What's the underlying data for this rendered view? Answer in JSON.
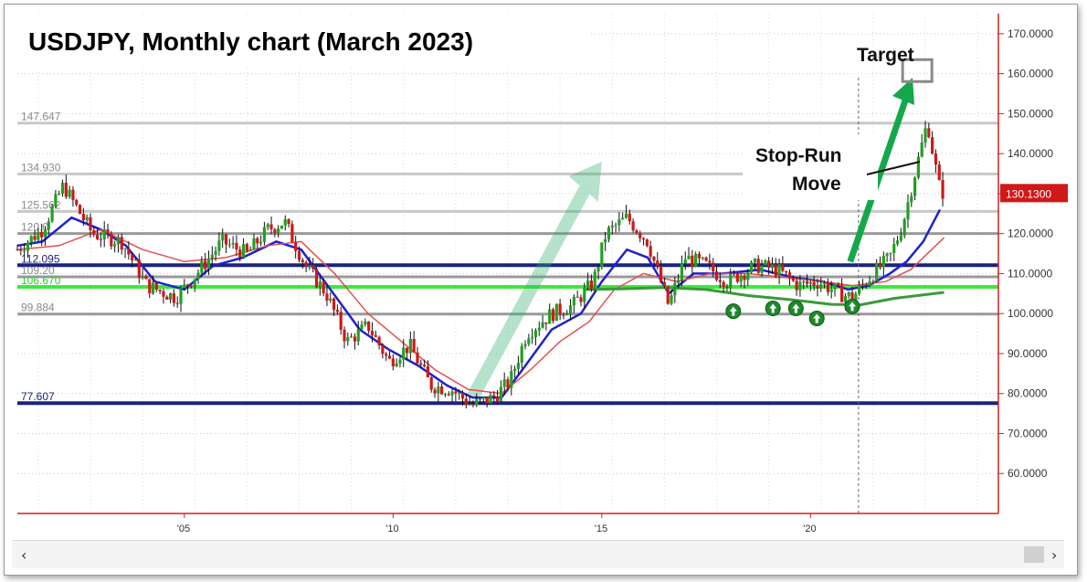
{
  "title": "USDJPY, Monthly chart (March 2023)",
  "chart_data": {
    "type": "candlestick",
    "instrument": "USDJPY",
    "timeframe": "Monthly",
    "current_price": "130.1300",
    "y_axis": {
      "range": [
        50,
        175
      ],
      "ticks": [
        "60.0000",
        "70.0000",
        "80.0000",
        "90.0000",
        "100.0000",
        "110.0000",
        "120.0000",
        "130.0000",
        "140.0000",
        "150.0000",
        "160.0000",
        "170.0000"
      ],
      "tick_values": [
        60,
        70,
        80,
        90,
        100,
        110,
        120,
        130,
        140,
        150,
        160,
        170
      ]
    },
    "x_axis": {
      "range": [
        2001.0,
        2024.5
      ],
      "ticks": [
        "'05",
        "'10",
        "'15",
        "'20"
      ],
      "tick_values": [
        2005,
        2010,
        2015,
        2020
      ]
    },
    "horizontal_levels": [
      {
        "label": "147.647",
        "value": 147.647,
        "color": "#c8c8c8"
      },
      {
        "label": "134.930",
        "value": 134.93,
        "color": "#c8c8c8"
      },
      {
        "label": "125.562",
        "value": 125.562,
        "color": "#c8c8c8"
      },
      {
        "label": "120.0",
        "value": 120.0,
        "color": "#9a9a9a"
      },
      {
        "label": "112.095",
        "value": 112.095,
        "color": "#1a237e"
      },
      {
        "label": "109.20",
        "value": 109.2,
        "color": "#9a9a9a"
      },
      {
        "label": "106.670",
        "value": 106.67,
        "color": "#3ee83e"
      },
      {
        "label": "99.884",
        "value": 99.884,
        "color": "#9a9a9a"
      },
      {
        "label": "77.607",
        "value": 77.607,
        "color": "#1a237e"
      }
    ],
    "price_path": [
      [
        2001.0,
        116
      ],
      [
        2001.6,
        121
      ],
      [
        2002.1,
        132
      ],
      [
        2002.8,
        120
      ],
      [
        2003.5,
        118
      ],
      [
        2004.1,
        107
      ],
      [
        2004.8,
        104
      ],
      [
        2005.3,
        110
      ],
      [
        2005.9,
        118
      ],
      [
        2006.5,
        115
      ],
      [
        2007.0,
        121
      ],
      [
        2007.4,
        123
      ],
      [
        2007.9,
        112
      ],
      [
        2008.4,
        105
      ],
      [
        2008.9,
        93
      ],
      [
        2009.4,
        97
      ],
      [
        2009.9,
        88
      ],
      [
        2010.4,
        92
      ],
      [
        2010.9,
        82
      ],
      [
        2011.4,
        81
      ],
      [
        2011.9,
        77
      ],
      [
        2012.4,
        79
      ],
      [
        2012.8,
        83
      ],
      [
        2013.2,
        95
      ],
      [
        2013.8,
        100
      ],
      [
        2014.3,
        102
      ],
      [
        2014.8,
        108
      ],
      [
        2015.1,
        120
      ],
      [
        2015.6,
        124
      ],
      [
        2016.1,
        118
      ],
      [
        2016.6,
        102
      ],
      [
        2017.0,
        114
      ],
      [
        2017.5,
        112
      ],
      [
        2018.0,
        108
      ],
      [
        2018.7,
        112
      ],
      [
        2019.2,
        111
      ],
      [
        2019.7,
        107
      ],
      [
        2020.2,
        108
      ],
      [
        2020.7,
        105
      ],
      [
        2021.0,
        104
      ],
      [
        2021.5,
        110
      ],
      [
        2021.9,
        114
      ],
      [
        2022.2,
        122
      ],
      [
        2022.5,
        135
      ],
      [
        2022.8,
        148
      ],
      [
        2022.95,
        139
      ],
      [
        2023.1,
        131
      ],
      [
        2023.2,
        130
      ]
    ],
    "series": [
      {
        "name": "",
        "color": "#2020d0",
        "values": [
          [
            2001.0,
            117
          ],
          [
            2001.6,
            118
          ],
          [
            2002.3,
            124
          ],
          [
            2003.0,
            121
          ],
          [
            2003.6,
            117
          ],
          [
            2004.3,
            108
          ],
          [
            2005.0,
            106
          ],
          [
            2005.7,
            112
          ],
          [
            2006.4,
            114
          ],
          [
            2007.2,
            118
          ],
          [
            2007.8,
            116
          ],
          [
            2008.5,
            106
          ],
          [
            2009.2,
            96
          ],
          [
            2009.9,
            91
          ],
          [
            2010.6,
            87
          ],
          [
            2011.3,
            82
          ],
          [
            2011.9,
            79
          ],
          [
            2012.6,
            79
          ],
          [
            2013.1,
            86
          ],
          [
            2013.8,
            96
          ],
          [
            2014.5,
            100
          ],
          [
            2015.0,
            108
          ],
          [
            2015.6,
            116
          ],
          [
            2016.1,
            114
          ],
          [
            2016.6,
            105
          ],
          [
            2017.2,
            110
          ],
          [
            2017.9,
            110
          ],
          [
            2018.8,
            111
          ],
          [
            2019.6,
            109
          ],
          [
            2020.3,
            108
          ],
          [
            2020.9,
            106
          ],
          [
            2021.4,
            107
          ],
          [
            2021.9,
            110
          ],
          [
            2022.3,
            113
          ],
          [
            2022.7,
            118
          ],
          [
            2023.1,
            126
          ]
        ]
      },
      {
        "name": "",
        "color": "#e05050",
        "values": [
          [
            2001.0,
            116
          ],
          [
            2002.0,
            117
          ],
          [
            2003.0,
            121
          ],
          [
            2004.0,
            116
          ],
          [
            2005.0,
            113
          ],
          [
            2006.0,
            114
          ],
          [
            2007.0,
            117
          ],
          [
            2007.8,
            118
          ],
          [
            2008.6,
            110
          ],
          [
            2009.4,
            100
          ],
          [
            2010.2,
            93
          ],
          [
            2011.0,
            86
          ],
          [
            2011.8,
            81
          ],
          [
            2012.6,
            80
          ],
          [
            2013.3,
            86
          ],
          [
            2014.0,
            93
          ],
          [
            2014.7,
            98
          ],
          [
            2015.3,
            106
          ],
          [
            2016.0,
            110
          ],
          [
            2016.8,
            108
          ],
          [
            2017.6,
            110
          ],
          [
            2018.5,
            110
          ],
          [
            2019.4,
            109
          ],
          [
            2020.3,
            108
          ],
          [
            2021.0,
            107
          ],
          [
            2021.8,
            108
          ],
          [
            2022.4,
            111
          ],
          [
            2023.2,
            119
          ]
        ]
      },
      {
        "name": "",
        "color": "#3a9a3a",
        "values": [
          [
            2014.6,
            106
          ],
          [
            2015.5,
            106.2
          ],
          [
            2016.5,
            106.5
          ],
          [
            2017.5,
            106
          ],
          [
            2018.5,
            104.5
          ],
          [
            2019.5,
            103.5
          ],
          [
            2020.5,
            102.3
          ],
          [
            2021.2,
            102.2
          ],
          [
            2022.0,
            103.8
          ],
          [
            2023.2,
            105.3
          ]
        ]
      }
    ],
    "marker_arrows": [
      {
        "x": 2018.15,
        "y": 100.6
      },
      {
        "x": 2019.1,
        "y": 101.3
      },
      {
        "x": 2019.65,
        "y": 101.3
      },
      {
        "x": 2020.15,
        "y": 98.8
      },
      {
        "x": 2021.0,
        "y": 101.8
      }
    ],
    "vertical_marker_x": 2021.15,
    "annotations": [
      {
        "text": "Target"
      },
      {
        "text": "Stop-Run"
      },
      {
        "text": "Move"
      }
    ],
    "target_price": 161.0
  }
}
